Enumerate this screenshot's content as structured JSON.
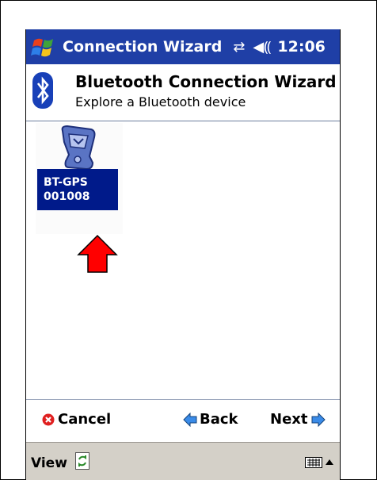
{
  "titlebar": {
    "title": "Connection Wizard",
    "connectivity_icon": "connectivity-icon",
    "speaker_icon": "speaker-icon",
    "clock": "12:06",
    "bg_color": "#1f3fa6"
  },
  "header": {
    "title": "Bluetooth Connection Wizard",
    "subtitle": "Explore a Bluetooth device",
    "icon": "bluetooth-icon"
  },
  "devices": [
    {
      "name_line1": "BT-GPS",
      "name_line2": "001008",
      "icon": "gps-device-icon",
      "selected": true
    }
  ],
  "commands": {
    "cancel": "Cancel",
    "back": "Back",
    "next": "Next"
  },
  "menubar": {
    "view": "View",
    "sync_icon": "sync-icon",
    "keyboard_icon": "keyboard-icon"
  },
  "colors": {
    "selection": "#001a8a",
    "annotation_arrow": "#ff0000"
  }
}
